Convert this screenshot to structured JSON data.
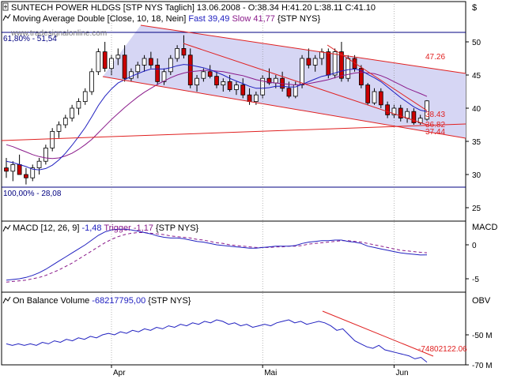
{
  "price_panel": {
    "title": "SUNTECH POWER HLDGS [STP NYS  Taglich] 13.06.2008 - O:38.34 H:41.20 L:38.11 C:41.10",
    "indicator_prefix": "Moving Average Double [Close, 10, 18, Nein]",
    "indicator_fast": "Fast 39,49",
    "indicator_slow": "Slow 41,77",
    "indicator_suffix": "{STP NYS}",
    "watermark": "www.tradesignalonline.com",
    "currency_label": "$",
    "fib_top_label": "61,80% - 51,54",
    "fib_bottom_label": "100,00% - 28,08",
    "level_labels": [
      "47.26",
      "38.43",
      "36.82",
      "37.44"
    ]
  },
  "macd_panel": {
    "label": "MACD [12, 26, 9]",
    "value": "-1,48",
    "trigger": "Trigger -1,17",
    "suffix": "{STP NYS}",
    "axis_title": "MACD"
  },
  "obv_panel": {
    "label": "On Balance Volume",
    "value": "-68217795,00",
    "suffix": "{STP NYS}",
    "axis_title": "OBV",
    "level_label": "-74802122.06"
  },
  "x_axis": {
    "labels": [
      "Apr",
      "Mai",
      "Jun"
    ]
  },
  "colors": {
    "up": "#ffffff",
    "down": "#cc0000",
    "fast_ma": "#2020c0",
    "slow_ma": "#8a1a8a",
    "channel": "#d0d0f0",
    "trend": "#e02020",
    "fib": "#000080"
  },
  "chart_data": [
    {
      "type": "candlestick",
      "y_ticks": [
        25,
        30,
        35,
        40,
        45,
        50
      ],
      "ylim": [
        24,
        53
      ],
      "x_tick_labels": [
        "Apr",
        "Mai",
        "Jun"
      ],
      "x_tick_index": [
        16,
        39,
        59
      ],
      "ohlc": [
        [
          31,
          32.5,
          29.5,
          30.5
        ],
        [
          30.5,
          32,
          29,
          31.5
        ],
        [
          31.5,
          33,
          30,
          30
        ],
        [
          30,
          31,
          28.5,
          29.5
        ],
        [
          29.5,
          31.5,
          29,
          31
        ],
        [
          31,
          32.5,
          30,
          32
        ],
        [
          32,
          34.5,
          31.5,
          34
        ],
        [
          34,
          37,
          33.5,
          36.5
        ],
        [
          36.5,
          38,
          35.5,
          37.5
        ],
        [
          37.5,
          39,
          37,
          38.5
        ],
        [
          38.5,
          40.5,
          38,
          40
        ],
        [
          40,
          41.5,
          39,
          41
        ],
        [
          41,
          43,
          40.5,
          42.5
        ],
        [
          42.5,
          46,
          42,
          45.5
        ],
        [
          45.5,
          49,
          45,
          48.5
        ],
        [
          48.5,
          50,
          45.5,
          46
        ],
        [
          46,
          48,
          45,
          47.5
        ],
        [
          47.5,
          49,
          46.5,
          48
        ],
        [
          48,
          49.5,
          44,
          44.5
        ],
        [
          44.5,
          46,
          44,
          45.5
        ],
        [
          45.5,
          47,
          44.5,
          46.5
        ],
        [
          46.5,
          48,
          45.5,
          47.5
        ],
        [
          47.5,
          48.5,
          46,
          46.5
        ],
        [
          46.5,
          47.5,
          43.5,
          44
        ],
        [
          44,
          46,
          43.5,
          45.5
        ],
        [
          45.5,
          48,
          45,
          47.5
        ],
        [
          47.5,
          49.5,
          47,
          49
        ],
        [
          49,
          51,
          47.5,
          48
        ],
        [
          48,
          49,
          43,
          43.5
        ],
        [
          43.5,
          45,
          42.5,
          44.5
        ],
        [
          44.5,
          46,
          44,
          45.5
        ],
        [
          45.5,
          46.5,
          44.5,
          44.8
        ],
        [
          44.8,
          45.5,
          43,
          43.5
        ],
        [
          43.5,
          44.5,
          42.5,
          44
        ],
        [
          44,
          45,
          42.5,
          42.8
        ],
        [
          42.8,
          44,
          42,
          43.5
        ],
        [
          43.5,
          44.5,
          41.5,
          42
        ],
        [
          42,
          43,
          40.5,
          41
        ],
        [
          41,
          42.5,
          40.5,
          42
        ],
        [
          42,
          45,
          41.5,
          44.5
        ],
        [
          44.5,
          46,
          43.5,
          43.8
        ],
        [
          43.8,
          45,
          43,
          44.5
        ],
        [
          44.5,
          45.5,
          42.5,
          43
        ],
        [
          43,
          44,
          41.5,
          41.8
        ],
        [
          41.8,
          44,
          41.5,
          43.5
        ],
        [
          43.5,
          48,
          43,
          47.5
        ],
        [
          47.5,
          49,
          46,
          46.5
        ],
        [
          46.5,
          48,
          45.5,
          47.5
        ],
        [
          47.5,
          49,
          46.5,
          48.5
        ],
        [
          48.5,
          49,
          44.5,
          45
        ],
        [
          45,
          49,
          44.5,
          48.5
        ],
        [
          48.5,
          50,
          44,
          44.5
        ],
        [
          44.5,
          48,
          44,
          47.5
        ],
        [
          47.5,
          48,
          45.5,
          46
        ],
        [
          46,
          46.5,
          43,
          43.5
        ],
        [
          43.5,
          43.8,
          40.5,
          40.8
        ],
        [
          40.8,
          43,
          40.5,
          42.5
        ],
        [
          42.5,
          43,
          40,
          40.5
        ],
        [
          40.5,
          41,
          38.5,
          39
        ],
        [
          39,
          40.5,
          38.5,
          40
        ],
        [
          40,
          40.5,
          38,
          38.5
        ],
        [
          38.5,
          40,
          37.8,
          39.5
        ],
        [
          39.5,
          40,
          37.5,
          37.8
        ],
        [
          37.8,
          39,
          37.5,
          38.5
        ],
        [
          38.34,
          41.2,
          38.11,
          41.1
        ]
      ],
      "series": [
        {
          "name": "Fast",
          "values": [
            32,
            31.8,
            31.5,
            31.2,
            30.8,
            30.7,
            30.9,
            31.4,
            32.2,
            33.2,
            34.4,
            35.7,
            37.1,
            38.7,
            40.4,
            41.8,
            42.9,
            43.8,
            44.3,
            44.8,
            45.2,
            45.6,
            45.9,
            45.9,
            45.9,
            46.1,
            46.4,
            46.6,
            46.5,
            46.3,
            46.1,
            45.8,
            45.4,
            45,
            44.5,
            44.1,
            43.7,
            43.3,
            43,
            43,
            43.1,
            43.3,
            43.3,
            43.2,
            43.2,
            43.6,
            44,
            44.4,
            44.8,
            45,
            45.3,
            45.6,
            45.8,
            45.9,
            45.7,
            45.1,
            44.6,
            44,
            43.2,
            42.4,
            41.6,
            40.9,
            40.2,
            39.7,
            39.49
          ]
        },
        {
          "name": "Slow",
          "values": [
            34.5,
            34.2,
            33.8,
            33.4,
            33,
            32.7,
            32.5,
            32.4,
            32.5,
            32.8,
            33.2,
            33.8,
            34.5,
            35.3,
            36.3,
            37.3,
            38.3,
            39.2,
            40.1,
            40.9,
            41.7,
            42.4,
            43,
            43.6,
            44.1,
            44.6,
            45,
            45.3,
            45.5,
            45.6,
            45.7,
            45.7,
            45.6,
            45.5,
            45.3,
            45.1,
            44.9,
            44.6,
            44.3,
            44.1,
            43.9,
            43.8,
            43.7,
            43.6,
            43.5,
            43.6,
            43.7,
            43.9,
            44.1,
            44.3,
            44.6,
            44.9,
            45.1,
            45.3,
            45.4,
            45.3,
            45.2,
            44.9,
            44.5,
            44,
            43.5,
            43,
            42.6,
            42.2,
            41.77
          ]
        }
      ]
    },
    {
      "type": "line",
      "y_ticks": [
        -5,
        0
      ],
      "ylim": [
        -6,
        3.5
      ],
      "series": [
        {
          "name": "MACD",
          "values": [
            -5.2,
            -5.1,
            -5,
            -4.8,
            -4.5,
            -4.1,
            -3.6,
            -3,
            -2.4,
            -1.8,
            -1.2,
            -0.6,
            0,
            0.7,
            1.4,
            1.9,
            2.2,
            2.3,
            2.3,
            2.2,
            2,
            1.8,
            1.6,
            1.3,
            1.1,
            1,
            1,
            0.9,
            0.7,
            0.5,
            0.4,
            0.2,
            0,
            -0.1,
            -0.2,
            -0.3,
            -0.4,
            -0.5,
            -0.5,
            -0.4,
            -0.3,
            -0.2,
            -0.2,
            -0.2,
            -0.1,
            0.2,
            0.4,
            0.5,
            0.6,
            0.6,
            0.7,
            0.7,
            0.5,
            0.4,
            0.2,
            -0.2,
            -0.4,
            -0.6,
            -0.8,
            -1,
            -1.2,
            -1.3,
            -1.4,
            -1.5,
            -1.48
          ]
        },
        {
          "name": "Trigger",
          "values": [
            -5.5,
            -5.4,
            -5.3,
            -5.2,
            -5,
            -4.8,
            -4.5,
            -4.1,
            -3.7,
            -3.2,
            -2.7,
            -2.1,
            -1.5,
            -0.9,
            -0.3,
            0.3,
            0.8,
            1.2,
            1.5,
            1.7,
            1.8,
            1.8,
            1.7,
            1.6,
            1.5,
            1.3,
            1.2,
            1.1,
            1,
            0.8,
            0.7,
            0.5,
            0.3,
            0.2,
            0,
            -0.1,
            -0.2,
            -0.3,
            -0.4,
            -0.4,
            -0.4,
            -0.3,
            -0.3,
            -0.2,
            -0.2,
            -0.1,
            0.1,
            0.2,
            0.3,
            0.4,
            0.5,
            0.6,
            0.6,
            0.5,
            0.4,
            0.2,
            0,
            -0.2,
            -0.4,
            -0.6,
            -0.8,
            -0.9,
            -1,
            -1.1,
            -1.17
          ]
        }
      ]
    },
    {
      "type": "line",
      "y_ticks": [
        -50,
        -70
      ],
      "y_tick_labels": [
        "-50 M",
        "-70 M"
      ],
      "ylim": [
        -80,
        -32
      ],
      "series": [
        {
          "name": "On Balance Volume",
          "values": [
            -56,
            -57,
            -56,
            -57,
            -56,
            -57,
            -55,
            -56,
            -54,
            -55,
            -53,
            -54,
            -52,
            -53,
            -51,
            -52,
            -50,
            -49,
            -50,
            -48,
            -49,
            -47,
            -48,
            -46,
            -47,
            -45,
            -46,
            -44,
            -45,
            -43,
            -44,
            -42,
            -43,
            -41,
            -42,
            -40,
            -41,
            -43,
            -42,
            -44,
            -43,
            -45,
            -44,
            -43,
            -44,
            -42,
            -41,
            -40,
            -42,
            -41,
            -43,
            -42,
            -41,
            -42,
            -44,
            -47,
            -46,
            -50,
            -54,
            -56,
            -58,
            -59,
            -57,
            -60,
            -61,
            -62,
            -63,
            -64,
            -66,
            -65,
            -68.2
          ]
        }
      ]
    }
  ]
}
